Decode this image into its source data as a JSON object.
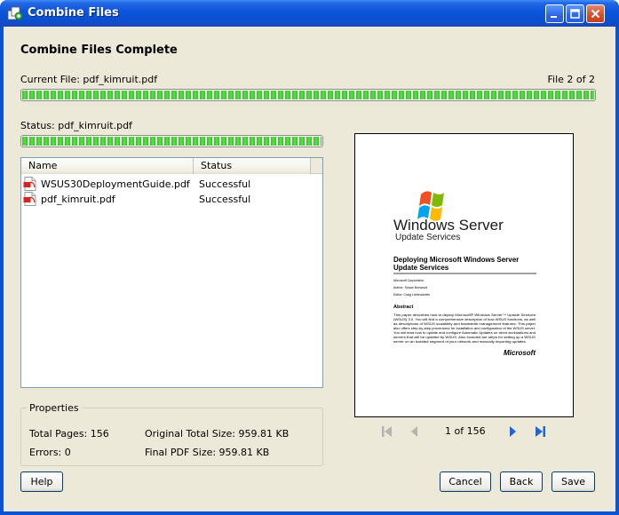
{
  "window": {
    "title": "Combine Files"
  },
  "heading": "Combine Files Complete",
  "current_file": {
    "label": "Current File: pdf_kimruit.pdf",
    "count": "File 2 of 2",
    "progress": 1.0
  },
  "status": {
    "label": "Status: pdf_kimruit.pdf",
    "progress": 1.0
  },
  "file_list": {
    "columns": [
      "Name",
      "Status"
    ],
    "rows": [
      {
        "name": "WSUS30DeploymentGuide.pdf",
        "status": "Successful",
        "icon": "pdf-file-icon"
      },
      {
        "name": "pdf_kimruit.pdf",
        "status": "Successful",
        "icon": "pdf-file-icon"
      }
    ]
  },
  "properties": {
    "legend": "Properties",
    "total_pages": "Total Pages: 156",
    "errors": "Errors: 0",
    "original_size": "Original Total Size: 959.81 KB",
    "final_size": "Final PDF Size: 959.81 KB"
  },
  "preview": {
    "product_line1": "Windows Server",
    "product_line2": "Update Services",
    "doc_title_line1": "Deploying Microsoft Windows Server",
    "doc_title_line2": "Update Services",
    "meta": [
      "Microsoft Corporation",
      "Author: Susan Norwood",
      "Editor: Craig Liebendorfer"
    ],
    "abstract_heading": "Abstract",
    "abstract_lines": [
      "This paper describes how to deploy Microsoft® Windows Server™ Update Services",
      "(WSUS) 3.0. You will find a comprehensive description of how WSUS functions, as well",
      "as descriptions of WSUS scalability and bandwidth management features. This paper",
      "also offers step-by-step procedures for installation and configuration of the WSUS server.",
      "You will read how to update and configure Automatic Updates on client workstations and",
      "servers that will be updated by WSUS. Also included are steps for setting up a WSUS",
      "server on an isolated segment of your network and manually importing updates."
    ],
    "brand": "Microsoft",
    "page_indicator": "1 of 156"
  },
  "buttons": {
    "help": "Help",
    "cancel": "Cancel",
    "back": "Back",
    "save": "Save"
  },
  "colors": {
    "titlebar": "#0a55da",
    "client_bg": "#ece9d8",
    "progress_green": "#34c31f",
    "nav_active": "#1e66d8",
    "nav_disabled": "#b4b4b4"
  }
}
